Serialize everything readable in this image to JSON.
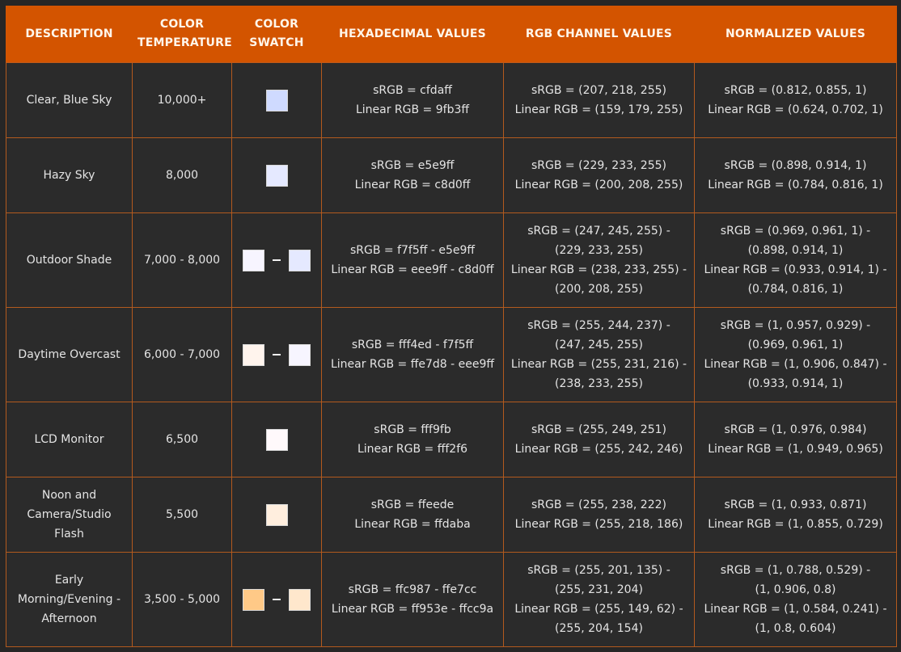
{
  "headers": {
    "description": "DESCRIPTION",
    "temperature": [
      "COLOR",
      "TEMPERATURE"
    ],
    "swatch": [
      "COLOR",
      "SWATCH"
    ],
    "hex": "HEXADECIMAL VALUES",
    "rgb": "RGB CHANNEL VALUES",
    "normalized": "NORMALIZED VALUES"
  },
  "colors": {
    "header_bg": "#d35400",
    "cell_bg": "#2b2b2b",
    "border": "#b35a1e"
  },
  "rows": [
    {
      "description": [
        "Clear, Blue Sky"
      ],
      "temperature": "10,000+",
      "swatches": [
        "#cfdaff"
      ],
      "hex": [
        "sRGB = cfdaff",
        "Linear RGB = 9fb3ff"
      ],
      "rgb": [
        "sRGB = (207, 218, 255)",
        "Linear RGB = (159, 179, 255)"
      ],
      "normalized": [
        "sRGB = (0.812, 0.855, 1)",
        "Linear RGB = (0.624, 0.702, 1)"
      ]
    },
    {
      "description": [
        "Hazy Sky"
      ],
      "temperature": "8,000",
      "swatches": [
        "#e5e9ff"
      ],
      "hex": [
        "sRGB = e5e9ff",
        "Linear RGB = c8d0ff"
      ],
      "rgb": [
        "sRGB = (229, 233, 255)",
        "Linear RGB = (200, 208, 255)"
      ],
      "normalized": [
        "sRGB = (0.898, 0.914, 1)",
        "Linear RGB = (0.784, 0.816, 1)"
      ]
    },
    {
      "description": [
        "Outdoor Shade"
      ],
      "temperature": "7,000 - 8,000",
      "swatches": [
        "#f7f5ff",
        "#e5e9ff"
      ],
      "hex": [
        "sRGB = f7f5ff - e5e9ff",
        "Linear RGB = eee9ff - c8d0ff"
      ],
      "rgb": [
        "sRGB = (247, 245, 255) -",
        "(229, 233, 255)",
        "Linear RGB = (238, 233, 255) -",
        "(200, 208, 255)"
      ],
      "normalized": [
        "sRGB = (0.969, 0.961, 1) -",
        "(0.898, 0.914, 1)",
        "Linear RGB = (0.933, 0.914, 1) -",
        "(0.784, 0.816, 1)"
      ]
    },
    {
      "description": [
        "Daytime Overcast"
      ],
      "temperature": "6,000 - 7,000",
      "swatches": [
        "#fff4ed",
        "#f7f5ff"
      ],
      "hex": [
        "sRGB = fff4ed - f7f5ff",
        "Linear RGB = ffe7d8 - eee9ff"
      ],
      "rgb": [
        "sRGB = (255, 244, 237) -",
        "(247, 245, 255)",
        "Linear RGB = (255, 231, 216) -",
        "(238, 233, 255)"
      ],
      "normalized": [
        "sRGB = (1, 0.957, 0.929) -",
        "(0.969, 0.961, 1)",
        "Linear RGB = (1, 0.906, 0.847) -",
        "(0.933, 0.914, 1)"
      ]
    },
    {
      "description": [
        "LCD Monitor"
      ],
      "temperature": "6,500",
      "swatches": [
        "#fff9fb"
      ],
      "hex": [
        "sRGB = fff9fb",
        "Linear RGB = fff2f6"
      ],
      "rgb": [
        "sRGB = (255, 249, 251)",
        "Linear RGB = (255, 242, 246)"
      ],
      "normalized": [
        "sRGB = (1, 0.976, 0.984)",
        "Linear RGB = (1, 0.949, 0.965)"
      ]
    },
    {
      "description": [
        "Noon and",
        "Camera/Studio",
        "Flash"
      ],
      "temperature": "5,500",
      "swatches": [
        "#ffeede"
      ],
      "hex": [
        "sRGB = ffeede",
        "Linear RGB = ffdaba"
      ],
      "rgb": [
        "sRGB = (255, 238, 222)",
        "Linear RGB = (255, 218, 186)"
      ],
      "normalized": [
        "sRGB = (1, 0.933, 0.871)",
        "Linear RGB = (1, 0.855, 0.729)"
      ]
    },
    {
      "description": [
        "Early",
        "Morning/Evening -",
        "Afternoon"
      ],
      "temperature": "3,500 - 5,000",
      "swatches": [
        "#ffc987",
        "#ffe7cc"
      ],
      "hex": [
        "sRGB = ffc987 - ffe7cc",
        "Linear RGB = ff953e - ffcc9a"
      ],
      "rgb": [
        "sRGB = (255, 201, 135) -",
        "(255, 231, 204)",
        "Linear RGB = (255, 149, 62) -",
        "(255, 204, 154)"
      ],
      "normalized": [
        "sRGB = (1, 0.788, 0.529) -",
        "(1, 0.906, 0.8)",
        "Linear RGB = (1, 0.584, 0.241) -",
        "(1, 0.8, 0.604)"
      ]
    }
  ]
}
